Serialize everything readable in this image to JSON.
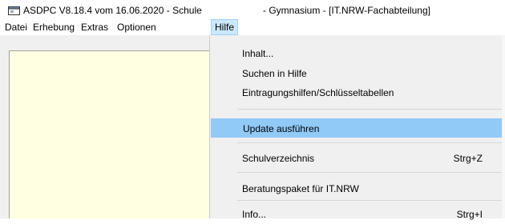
{
  "window": {
    "title_left": "ASDPC V8.18.4 vom 16.06.2020 - Schule",
    "title_right": "- Gymnasium - [IT.NRW-Fachabteilung]",
    "icon": "app-window-icon"
  },
  "menubar": {
    "items": [
      "Datei",
      "Erhebung",
      "Extras",
      "Optionen",
      "Hilfe"
    ],
    "active": "Hilfe"
  },
  "help_menu": {
    "items": [
      {
        "label": "Inhalt...",
        "shortcut": ""
      },
      {
        "label": "Suchen in Hilfe",
        "shortcut": ""
      },
      {
        "label": "Eintragungshilfen/Schlüsseltabellen",
        "shortcut": ""
      },
      {
        "label": "Update ausführen",
        "shortcut": "",
        "highlighted": true
      },
      {
        "label": "Schulverzeichnis",
        "shortcut": "Strg+Z"
      },
      {
        "label": "Beratungspaket für IT.NRW",
        "shortcut": ""
      },
      {
        "label": "Info...",
        "shortcut": "Strg+I"
      }
    ]
  },
  "colors": {
    "panel_background": "#ffffe1",
    "menu_background": "#f0f0f0",
    "highlight": "#91c9f7",
    "active_menu": "#cce8ff"
  }
}
